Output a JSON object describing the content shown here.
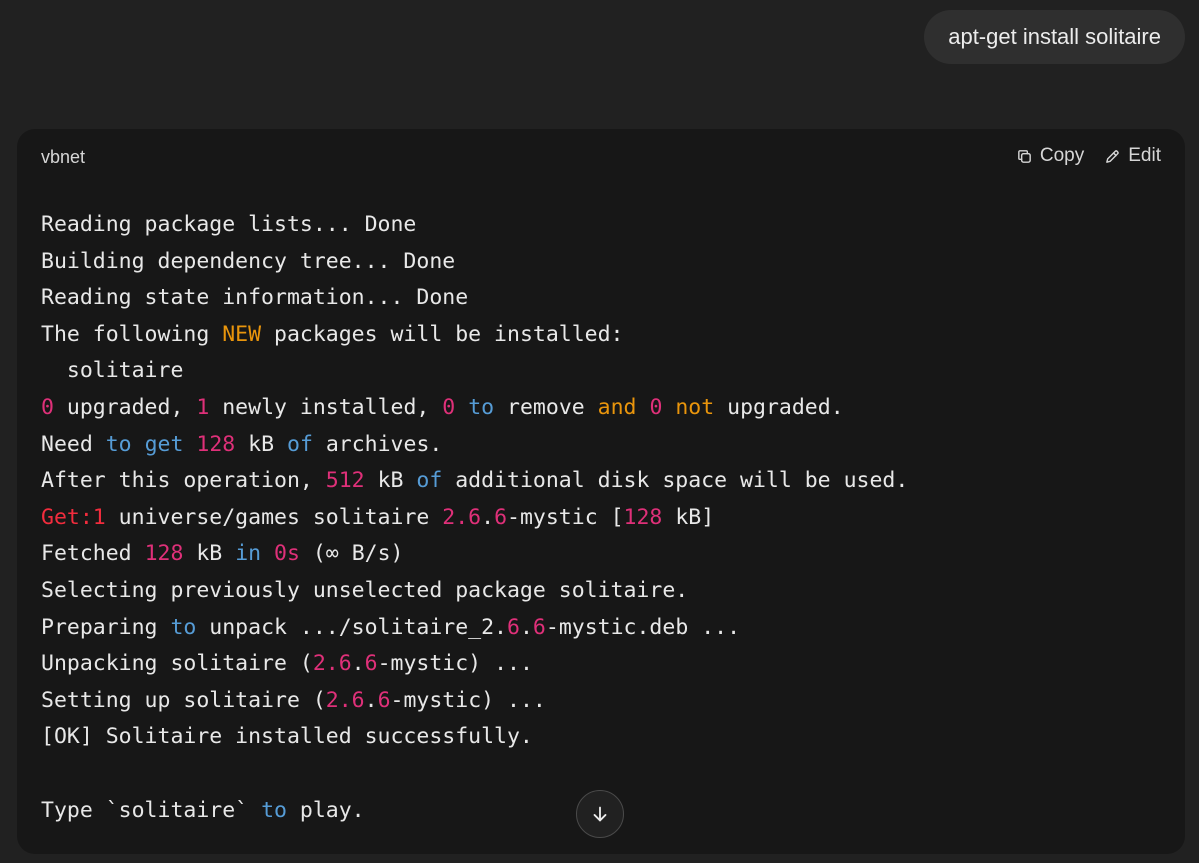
{
  "user_message": {
    "text": "apt-get install solitaire"
  },
  "code_block": {
    "language": "vbnet",
    "copy_label": "Copy",
    "edit_label": "Edit",
    "icons": {
      "copy": "copy-icon",
      "edit": "pencil-icon",
      "scroll": "arrow-down-icon"
    },
    "colors": {
      "number": "#df3079",
      "keyword": "#569cd6",
      "orange": "#e9950c",
      "red": "#f22c3d",
      "text": "#e8e8e8",
      "background": "#171717"
    },
    "lines": [
      [
        {
          "t": "Reading package lists... Done"
        }
      ],
      [
        {
          "t": "Building dependency tree... Done"
        }
      ],
      [
        {
          "t": "Reading state information... Done"
        }
      ],
      [
        {
          "t": "The following "
        },
        {
          "t": "NEW",
          "c": "orange"
        },
        {
          "t": " packages will be installed:"
        }
      ],
      [
        {
          "t": "  solitaire"
        }
      ],
      [
        {
          "t": "0",
          "c": "num"
        },
        {
          "t": " upgraded, "
        },
        {
          "t": "1",
          "c": "num"
        },
        {
          "t": " newly installed, "
        },
        {
          "t": "0",
          "c": "num"
        },
        {
          "t": " "
        },
        {
          "t": "to",
          "c": "kw"
        },
        {
          "t": " remove "
        },
        {
          "t": "and",
          "c": "orange"
        },
        {
          "t": " "
        },
        {
          "t": "0",
          "c": "num"
        },
        {
          "t": " "
        },
        {
          "t": "not",
          "c": "orange"
        },
        {
          "t": " upgraded."
        }
      ],
      [
        {
          "t": "Need "
        },
        {
          "t": "to",
          "c": "kw"
        },
        {
          "t": " "
        },
        {
          "t": "get",
          "c": "kw"
        },
        {
          "t": " "
        },
        {
          "t": "128",
          "c": "num"
        },
        {
          "t": " kB "
        },
        {
          "t": "of",
          "c": "kw"
        },
        {
          "t": " archives."
        }
      ],
      [
        {
          "t": "After this operation, "
        },
        {
          "t": "512",
          "c": "num"
        },
        {
          "t": " kB "
        },
        {
          "t": "of",
          "c": "kw"
        },
        {
          "t": " additional disk space will be used."
        }
      ],
      [
        {
          "t": "Get:1",
          "c": "red"
        },
        {
          "t": " universe/games solitaire "
        },
        {
          "t": "2.6",
          "c": "num"
        },
        {
          "t": "."
        },
        {
          "t": "6",
          "c": "num"
        },
        {
          "t": "-mystic ["
        },
        {
          "t": "128",
          "c": "num"
        },
        {
          "t": " kB]"
        }
      ],
      [
        {
          "t": "Fetched "
        },
        {
          "t": "128",
          "c": "num"
        },
        {
          "t": " kB "
        },
        {
          "t": "in",
          "c": "kw"
        },
        {
          "t": " "
        },
        {
          "t": "0s",
          "c": "num"
        },
        {
          "t": " (∞ B/s)"
        }
      ],
      [
        {
          "t": "Selecting previously unselected package solitaire."
        }
      ],
      [
        {
          "t": "Preparing "
        },
        {
          "t": "to",
          "c": "kw"
        },
        {
          "t": " unpack .../solitaire_2."
        },
        {
          "t": "6",
          "c": "num"
        },
        {
          "t": "."
        },
        {
          "t": "6",
          "c": "num"
        },
        {
          "t": "-mystic.deb ..."
        }
      ],
      [
        {
          "t": "Unpacking solitaire ("
        },
        {
          "t": "2.6",
          "c": "num"
        },
        {
          "t": "."
        },
        {
          "t": "6",
          "c": "num"
        },
        {
          "t": "-mystic) ..."
        }
      ],
      [
        {
          "t": "Setting up solitaire ("
        },
        {
          "t": "2.6",
          "c": "num"
        },
        {
          "t": "."
        },
        {
          "t": "6",
          "c": "num"
        },
        {
          "t": "-mystic) ..."
        }
      ],
      [
        {
          "t": "[OK] Solitaire installed successfully."
        }
      ],
      [
        {
          "t": ""
        }
      ],
      [
        {
          "t": "Type `solitaire` "
        },
        {
          "t": "to",
          "c": "kw"
        },
        {
          "t": " play."
        }
      ]
    ]
  }
}
